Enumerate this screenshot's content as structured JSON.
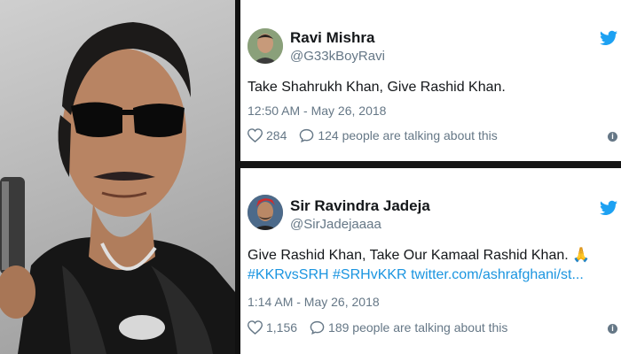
{
  "tweets": [
    {
      "name": "Ravi Mishra",
      "handle": "@G33kBoyRavi",
      "text": "Take Shahrukh Khan, Give Rashid Khan.",
      "time": "12:50 AM - May 26, 2018",
      "likes": "284",
      "replies": "124 people are talking about this"
    },
    {
      "name": "Sir Ravindra Jadeja",
      "handle": "@SirJadejaaaa",
      "text_line1": "Give Rashid Khan, Take Our Kamaal Rashid Khan.",
      "emoji": "🙏",
      "hashtag1": "#KKRvsSRH",
      "hashtag2": "#SRHvKKR",
      "link": "twitter.com/ashrafghani/st...",
      "time": "1:14 AM - May 26, 2018",
      "likes": "1,156",
      "replies": "189 people are talking about this"
    }
  ],
  "icons": {
    "bird": "twitter-bird-icon",
    "heart": "heart-icon",
    "reply": "speech-bubble-icon",
    "info": "info-icon"
  },
  "colors": {
    "accent": "#1b95e0",
    "muted": "#657786",
    "text": "#14171a"
  }
}
